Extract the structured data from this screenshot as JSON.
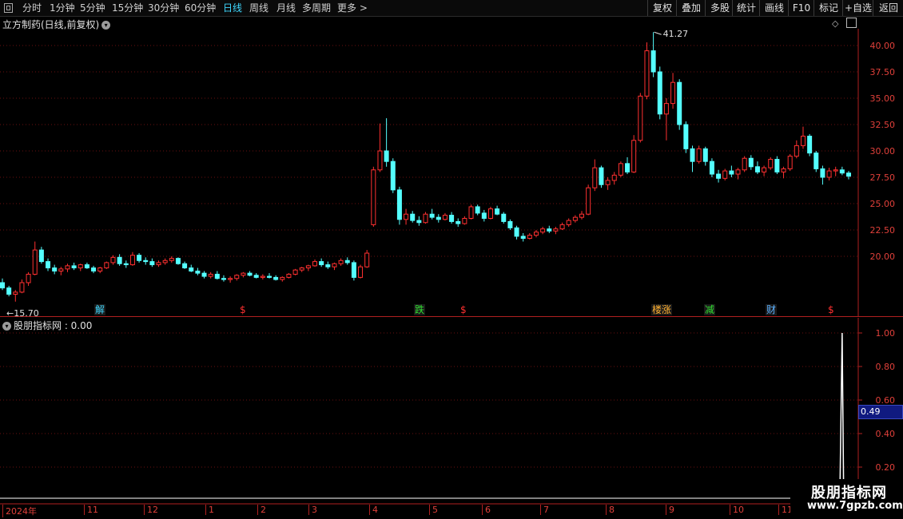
{
  "toolbar": {
    "periods": [
      {
        "label": "分时",
        "active": false
      },
      {
        "label": "1分钟",
        "active": false
      },
      {
        "label": "5分钟",
        "active": false
      },
      {
        "label": "15分钟",
        "active": false
      },
      {
        "label": "30分钟",
        "active": false
      },
      {
        "label": "60分钟",
        "active": false
      },
      {
        "label": "日线",
        "active": true
      },
      {
        "label": "周线",
        "active": false
      },
      {
        "label": "月线",
        "active": false
      },
      {
        "label": "多周期",
        "active": false
      },
      {
        "label": "更多 >",
        "active": false
      }
    ],
    "actions": [
      "复权",
      "叠加",
      "多股",
      "统计",
      "画线",
      "F10",
      "标记",
      "+自选",
      "返回"
    ]
  },
  "main_chart": {
    "title": "立方制药(日线,前复权)",
    "high_label": "41.27",
    "low_label": "←15.70",
    "y_ticks": [
      "40.00",
      "37.50",
      "35.00",
      "32.50",
      "30.00",
      "27.50",
      "25.00",
      "22.50",
      "20.00"
    ],
    "markers": [
      {
        "text": "解",
        "color": "#3fd8ff"
      },
      {
        "text": "$",
        "color": "#ff3030"
      },
      {
        "text": "跌",
        "color": "#30e030"
      },
      {
        "text": "$",
        "color": "#ff3030"
      },
      {
        "text": "楼涨",
        "color": "#ffb030"
      },
      {
        "text": "减",
        "color": "#30e030"
      },
      {
        "text": "财",
        "color": "#5ab0ff"
      },
      {
        "text": "$",
        "color": "#ff3030"
      }
    ]
  },
  "indicator": {
    "title": "股朋指标网 : 0.00",
    "y_ticks": [
      "1.00",
      "0.80",
      "0.60",
      "0.40",
      "0.20"
    ],
    "current_value": "0.49"
  },
  "x_axis": {
    "labels": [
      "2024年",
      "11",
      "12",
      "1",
      "2",
      "3",
      "4",
      "5",
      "6",
      "7",
      "8",
      "9",
      "10",
      "11"
    ]
  },
  "watermark": {
    "line1": "股朋指标网",
    "line2": "www.7gpzb.com"
  },
  "colors": {
    "up": "#ff3030",
    "down": "#54ffff",
    "grid": "#6a1010",
    "axis": "#e0403a",
    "highlight": "#3fd8ff"
  },
  "chart_data": {
    "type": "candlestick",
    "series": [
      {
        "name": "立方制药",
        "ohlc": [
          [
            17.5,
            17.9,
            16.8,
            17.0
          ],
          [
            17.0,
            17.2,
            16.2,
            16.4
          ],
          [
            16.4,
            16.8,
            15.7,
            16.6
          ],
          [
            16.6,
            17.8,
            16.5,
            17.5
          ],
          [
            17.5,
            18.5,
            17.2,
            18.3
          ],
          [
            18.3,
            21.4,
            18.2,
            20.6
          ],
          [
            20.6,
            20.9,
            19.3,
            19.5
          ],
          [
            19.5,
            19.8,
            18.6,
            18.9
          ],
          [
            18.9,
            19.2,
            18.3,
            18.6
          ],
          [
            18.6,
            19.0,
            18.2,
            18.8
          ],
          [
            18.8,
            19.3,
            18.5,
            19.1
          ],
          [
            19.1,
            19.4,
            18.7,
            18.9
          ],
          [
            18.9,
            19.3,
            18.6,
            19.2
          ],
          [
            19.2,
            19.4,
            18.8,
            18.9
          ],
          [
            18.9,
            19.1,
            18.4,
            18.6
          ],
          [
            18.6,
            19.0,
            18.4,
            18.9
          ],
          [
            18.9,
            19.5,
            18.8,
            19.4
          ],
          [
            19.4,
            20.1,
            19.2,
            19.9
          ],
          [
            19.9,
            20.2,
            19.1,
            19.3
          ],
          [
            19.3,
            19.6,
            18.9,
            19.2
          ],
          [
            19.2,
            20.4,
            19.1,
            20.1
          ],
          [
            20.1,
            20.3,
            19.4,
            19.6
          ],
          [
            19.6,
            19.9,
            19.2,
            19.5
          ],
          [
            19.5,
            19.8,
            19.0,
            19.2
          ],
          [
            19.2,
            19.6,
            19.0,
            19.4
          ],
          [
            19.4,
            19.8,
            19.2,
            19.6
          ],
          [
            19.6,
            20.0,
            19.4,
            19.8
          ],
          [
            19.8,
            19.9,
            19.2,
            19.3
          ],
          [
            19.3,
            19.5,
            18.8,
            18.9
          ],
          [
            18.9,
            19.2,
            18.5,
            18.6
          ],
          [
            18.6,
            18.9,
            18.2,
            18.4
          ],
          [
            18.4,
            18.6,
            17.9,
            18.1
          ],
          [
            18.1,
            18.5,
            17.9,
            18.3
          ],
          [
            18.3,
            18.6,
            17.8,
            17.9
          ],
          [
            17.9,
            18.2,
            17.6,
            17.8
          ],
          [
            17.8,
            18.1,
            17.5,
            17.9
          ],
          [
            17.9,
            18.3,
            17.7,
            18.2
          ],
          [
            18.2,
            18.5,
            18.0,
            18.4
          ],
          [
            18.4,
            18.6,
            18.1,
            18.2
          ],
          [
            18.2,
            18.4,
            17.9,
            18.0
          ],
          [
            18.0,
            18.3,
            17.8,
            18.1
          ],
          [
            18.1,
            18.4,
            17.9,
            18.0
          ],
          [
            18.0,
            18.2,
            17.7,
            17.8
          ],
          [
            17.8,
            18.1,
            17.6,
            18.0
          ],
          [
            18.0,
            18.4,
            17.9,
            18.3
          ],
          [
            18.3,
            18.8,
            18.2,
            18.7
          ],
          [
            18.7,
            19.0,
            18.5,
            18.9
          ],
          [
            18.9,
            19.2,
            18.6,
            19.1
          ],
          [
            19.1,
            19.7,
            19.0,
            19.5
          ],
          [
            19.5,
            19.8,
            19.0,
            19.2
          ],
          [
            19.2,
            19.5,
            18.8,
            19.0
          ],
          [
            19.0,
            19.4,
            18.7,
            19.3
          ],
          [
            19.3,
            19.8,
            19.1,
            19.6
          ],
          [
            19.6,
            19.9,
            19.2,
            19.4
          ],
          [
            19.4,
            19.6,
            17.7,
            18.0
          ],
          [
            18.0,
            19.2,
            17.9,
            19.0
          ],
          [
            19.0,
            20.6,
            18.9,
            20.3
          ],
          [
            23.0,
            28.5,
            22.8,
            28.2
          ],
          [
            28.2,
            32.6,
            28.0,
            30.0
          ],
          [
            30.0,
            33.1,
            28.5,
            29.0
          ],
          [
            29.0,
            29.3,
            26.0,
            26.3
          ],
          [
            26.3,
            26.6,
            23.0,
            23.5
          ],
          [
            23.5,
            24.5,
            23.0,
            24.0
          ],
          [
            24.0,
            24.3,
            23.2,
            23.4
          ],
          [
            23.4,
            23.8,
            22.9,
            23.2
          ],
          [
            23.2,
            24.2,
            23.1,
            24.0
          ],
          [
            24.0,
            24.5,
            23.5,
            23.7
          ],
          [
            23.7,
            24.0,
            23.2,
            23.5
          ],
          [
            23.5,
            24.1,
            23.4,
            23.9
          ],
          [
            23.9,
            24.2,
            23.1,
            23.3
          ],
          [
            23.3,
            23.6,
            22.8,
            23.1
          ],
          [
            23.1,
            23.8,
            23.0,
            23.6
          ],
          [
            23.6,
            24.9,
            23.5,
            24.7
          ],
          [
            24.7,
            24.9,
            23.9,
            24.1
          ],
          [
            24.1,
            24.4,
            23.3,
            23.6
          ],
          [
            23.6,
            24.7,
            23.5,
            24.5
          ],
          [
            24.5,
            24.8,
            23.9,
            24.0
          ],
          [
            24.0,
            24.2,
            23.1,
            23.3
          ],
          [
            23.3,
            23.5,
            22.5,
            22.7
          ],
          [
            22.7,
            22.9,
            21.6,
            21.9
          ],
          [
            21.9,
            22.2,
            21.4,
            21.7
          ],
          [
            21.7,
            22.2,
            21.6,
            22.0
          ],
          [
            22.0,
            22.5,
            21.8,
            22.3
          ],
          [
            22.3,
            22.8,
            22.1,
            22.6
          ],
          [
            22.6,
            22.9,
            22.2,
            22.4
          ],
          [
            22.4,
            22.8,
            22.1,
            22.6
          ],
          [
            22.6,
            23.2,
            22.5,
            23.0
          ],
          [
            23.0,
            23.6,
            22.8,
            23.4
          ],
          [
            23.4,
            23.9,
            23.2,
            23.7
          ],
          [
            23.7,
            24.3,
            23.5,
            24.0
          ],
          [
            24.0,
            26.8,
            23.9,
            26.5
          ],
          [
            26.5,
            29.2,
            26.2,
            28.4
          ],
          [
            28.4,
            28.6,
            26.5,
            26.8
          ],
          [
            26.8,
            27.5,
            26.3,
            27.2
          ],
          [
            27.2,
            28.0,
            26.8,
            27.7
          ],
          [
            27.7,
            29.0,
            27.5,
            28.8
          ],
          [
            28.8,
            29.4,
            27.8,
            28.0
          ],
          [
            28.0,
            31.5,
            27.9,
            31.0
          ],
          [
            31.0,
            35.5,
            30.8,
            35.2
          ],
          [
            35.2,
            40.3,
            34.9,
            39.5
          ],
          [
            39.5,
            41.27,
            37.0,
            37.5
          ],
          [
            37.5,
            38.0,
            33.0,
            33.5
          ],
          [
            33.5,
            35.0,
            31.0,
            34.5
          ],
          [
            34.5,
            37.4,
            34.0,
            36.5
          ],
          [
            36.5,
            36.8,
            32.0,
            32.5
          ],
          [
            32.5,
            32.8,
            29.8,
            30.2
          ],
          [
            30.2,
            30.5,
            28.0,
            29.0
          ],
          [
            29.0,
            30.5,
            28.8,
            30.2
          ],
          [
            30.2,
            30.4,
            28.6,
            29.0
          ],
          [
            29.0,
            29.3,
            27.5,
            27.8
          ],
          [
            27.8,
            28.2,
            27.0,
            27.4
          ],
          [
            27.4,
            28.3,
            27.2,
            28.1
          ],
          [
            28.1,
            28.6,
            27.5,
            27.8
          ],
          [
            27.8,
            28.4,
            27.3,
            28.2
          ],
          [
            28.2,
            29.5,
            28.0,
            29.3
          ],
          [
            29.3,
            29.6,
            28.2,
            28.5
          ],
          [
            28.5,
            29.0,
            27.8,
            28.0
          ],
          [
            28.0,
            28.6,
            27.6,
            28.4
          ],
          [
            28.4,
            29.4,
            28.2,
            29.2
          ],
          [
            29.2,
            29.5,
            27.8,
            28.0
          ],
          [
            28.0,
            28.5,
            27.4,
            28.3
          ],
          [
            28.3,
            29.7,
            28.1,
            29.5
          ],
          [
            29.5,
            31.0,
            29.3,
            30.5
          ],
          [
            30.5,
            32.3,
            30.2,
            31.4
          ],
          [
            31.4,
            31.6,
            29.5,
            29.8
          ],
          [
            29.8,
            30.0,
            28.0,
            28.3
          ],
          [
            28.3,
            28.6,
            26.8,
            27.5
          ],
          [
            27.5,
            28.4,
            27.2,
            28.1
          ],
          [
            28.1,
            28.5,
            27.6,
            28.2
          ],
          [
            28.2,
            28.5,
            27.7,
            27.9
          ],
          [
            27.9,
            28.1,
            27.3,
            27.6
          ]
        ]
      }
    ],
    "y_range": [
      15.0,
      42.0
    ],
    "indicator_series": {
      "name": "股朋指标网",
      "range": [
        0,
        1
      ],
      "spike_at_index": 129,
      "spike_value": 1.0
    }
  }
}
